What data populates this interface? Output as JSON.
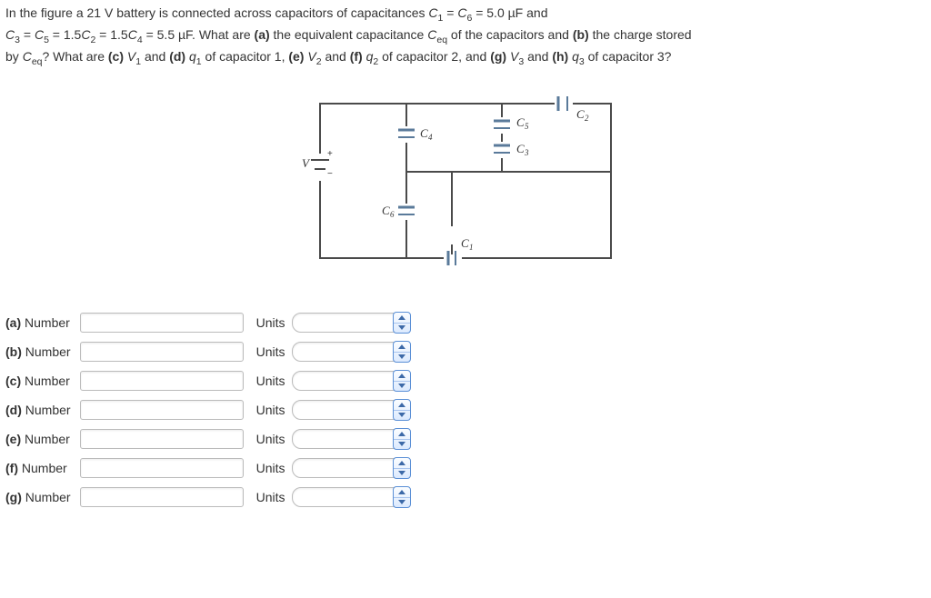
{
  "problem": {
    "line1_pre": "In the figure a ",
    "voltage": "21 V",
    "line1_mid": " battery is connected across capacitors of capacitances ",
    "c1c6": "C₁ = C₆ = 5.0 µF",
    "line1_post": " and",
    "line2_a": "C₃ = C₅ = 1.5C₂ = 1.5C₄ = 5.5 µF. What are ",
    "part_a_label": "(a)",
    "line2_b": " the equivalent capacitance ",
    "ceq_sym": "Cₑq",
    "line2_c": " of the capacitors and ",
    "part_b_label": "(b)",
    "line2_d": " the charge stored",
    "line3_a": "by ",
    "line3_b": "? What are ",
    "part_c_label": "(c)",
    "v1": " V₁ ",
    "and": "and ",
    "part_d_label": "(d)",
    "q1": " q₁ ",
    "cap1": "of capacitor 1, ",
    "part_e_label": "(e)",
    "v2": " V₂ ",
    "part_f_label": "(f)",
    "q2": " q₂ ",
    "cap2": "of capacitor 2, and ",
    "part_g_label": "(g)",
    "v3": " V₃ ",
    "part_h_label": "(h)",
    "q3": " q₃ ",
    "cap3": "of capacitor 3?"
  },
  "figure_labels": {
    "V": "V",
    "C1": "C",
    "C1s": "1",
    "C2": "C",
    "C2s": "2",
    "C3": "C",
    "C3s": "3",
    "C4": "C",
    "C4s": "4",
    "C5": "C",
    "C5s": "5",
    "C6": "C",
    "C6s": "6",
    "plus": "+",
    "minus": "−"
  },
  "answers": {
    "number_word": "Number",
    "units_word": "Units",
    "rows": [
      {
        "tag": "(a)"
      },
      {
        "tag": "(b)"
      },
      {
        "tag": "(c)"
      },
      {
        "tag": "(d)"
      },
      {
        "tag": "(e)"
      },
      {
        "tag": "(f)"
      },
      {
        "tag": "(g)"
      }
    ]
  }
}
